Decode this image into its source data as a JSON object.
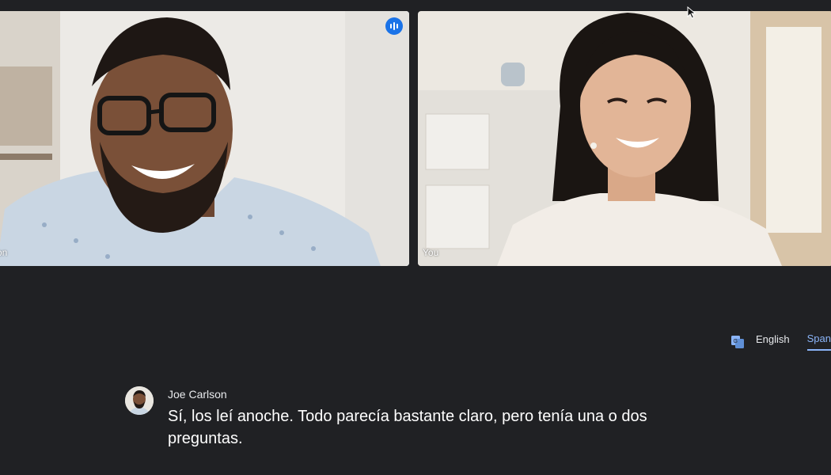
{
  "participants": [
    {
      "name_label": "son",
      "speaking_icon": "audio-waveform-icon",
      "highlight_color": "#8ab4f8"
    },
    {
      "name_label": "You"
    }
  ],
  "translation": {
    "icon": "translate-icon",
    "languages": [
      "English",
      "Span"
    ],
    "active": "Span"
  },
  "caption": {
    "speaker": "Joe Carlson",
    "text": "Sí, los leí anoche. Todo parecía bastante claro, pero tenía una o dos preguntas."
  },
  "colors": {
    "background": "#202124",
    "accent": "#8ab4f8",
    "badge": "#1a73e8"
  }
}
